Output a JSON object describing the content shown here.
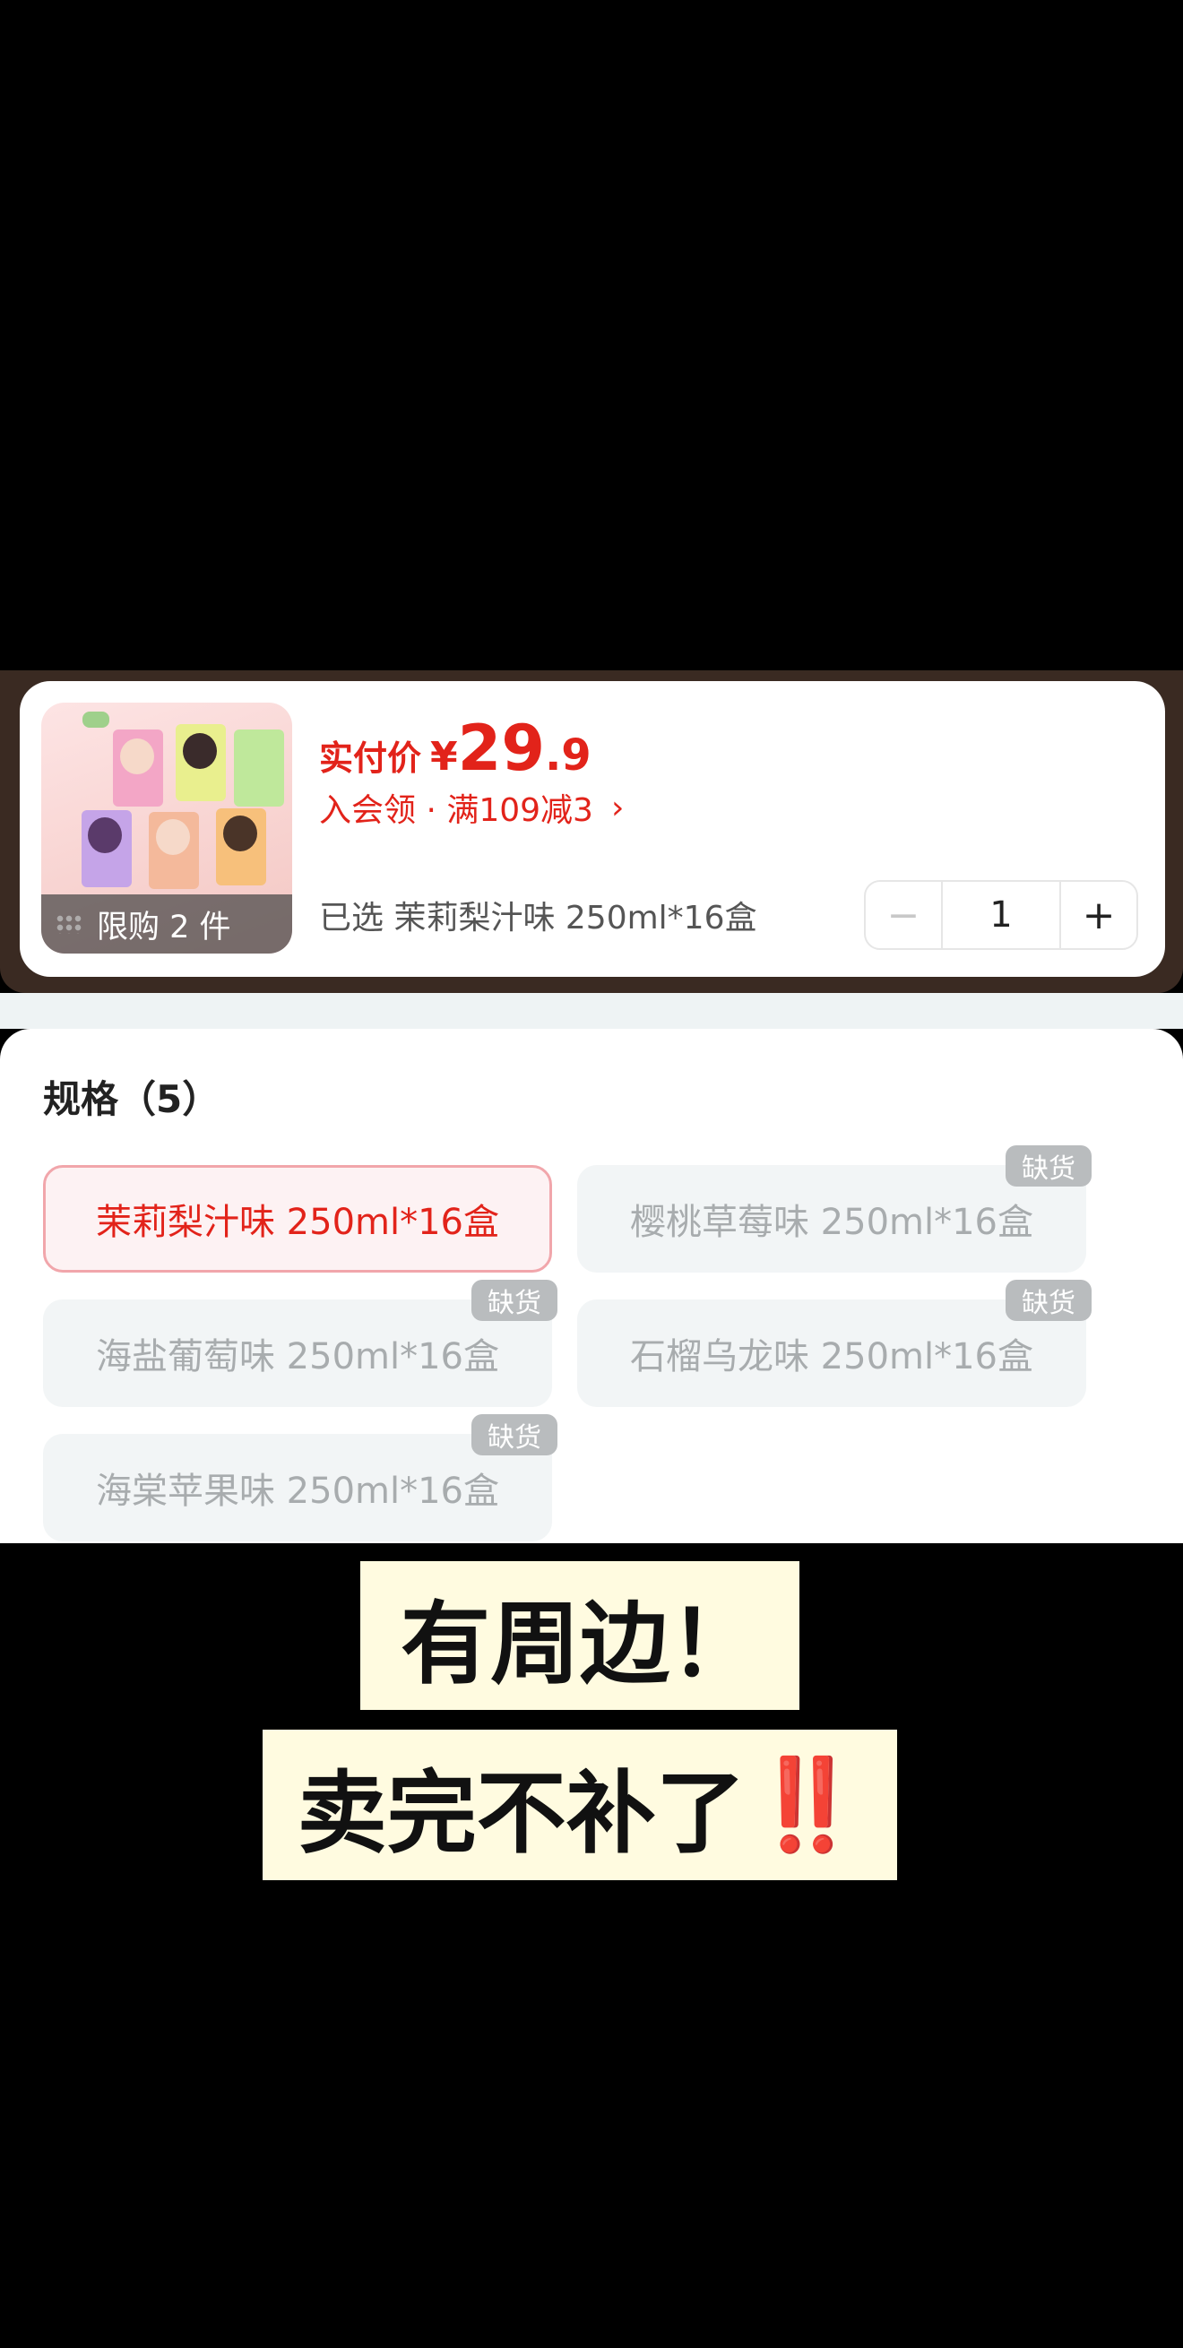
{
  "product": {
    "price_label": "实付价",
    "currency": "¥",
    "price_int": "29",
    "price_dec": ".9",
    "promo_text": "入会领 · 满109减3",
    "promo_chevron": "›",
    "limit_text": "限购 2 件",
    "selected_text": "已选 茉莉梨汁味 250ml*16盒",
    "quantity": "1",
    "minus_label": "−",
    "plus_label": "+"
  },
  "spec": {
    "title": "规格（5）",
    "options": [
      {
        "label": "茉莉梨汁味 250ml*16盒",
        "selected": true,
        "badge": ""
      },
      {
        "label": "樱桃草莓味 250ml*16盒",
        "selected": false,
        "badge": "缺货"
      },
      {
        "label": "海盐葡萄味 250ml*16盒",
        "selected": false,
        "badge": "缺货"
      },
      {
        "label": "石榴乌龙味 250ml*16盒",
        "selected": false,
        "badge": "缺货"
      },
      {
        "label": "海棠苹果味 250ml*16盒",
        "selected": false,
        "badge": "缺货"
      }
    ]
  },
  "captions": {
    "line1": "有周边！",
    "line2": "卖完不补了",
    "line2_emphasis": "‼️"
  },
  "colors": {
    "accent_red": "#e2231a",
    "selected_border": "#f1a6ab",
    "badge_gray": "#b9bcbe",
    "caption_bg": "#fffbe0"
  }
}
